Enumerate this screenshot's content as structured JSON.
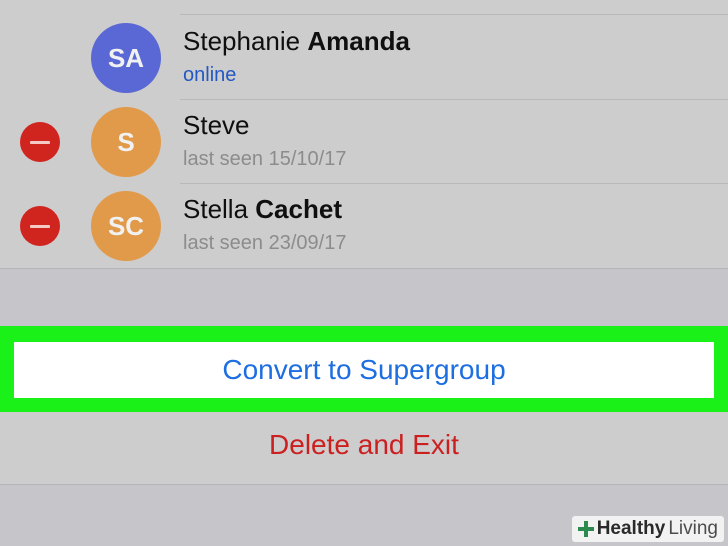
{
  "members": [
    {
      "initials": "SA",
      "first_name": "Stephanie",
      "last_name": "Amanda",
      "status": "online",
      "avatar_color": "#5a68d5",
      "removable": false
    },
    {
      "initials": "S",
      "first_name": "Steve",
      "last_name": "",
      "status": "last seen 15/10/17",
      "avatar_color": "#e09a4a",
      "removable": true
    },
    {
      "initials": "SC",
      "first_name": "Stella",
      "last_name": "Cachet",
      "status": "last seen 23/09/17",
      "avatar_color": "#e09a4a",
      "removable": true
    }
  ],
  "actions": {
    "convert_label": "Convert to Supergroup",
    "delete_label": "Delete and Exit"
  },
  "colors": {
    "highlight": "#19f119",
    "link_blue": "#1d6ee0",
    "destructive_red": "#cc2020",
    "online_blue": "#2358c4"
  },
  "icons": {
    "remove": "minus-circle-icon",
    "watermark": "plus-cross-icon"
  },
  "watermark": {
    "brand_bold": "Healthy",
    "brand_light": "Living"
  }
}
